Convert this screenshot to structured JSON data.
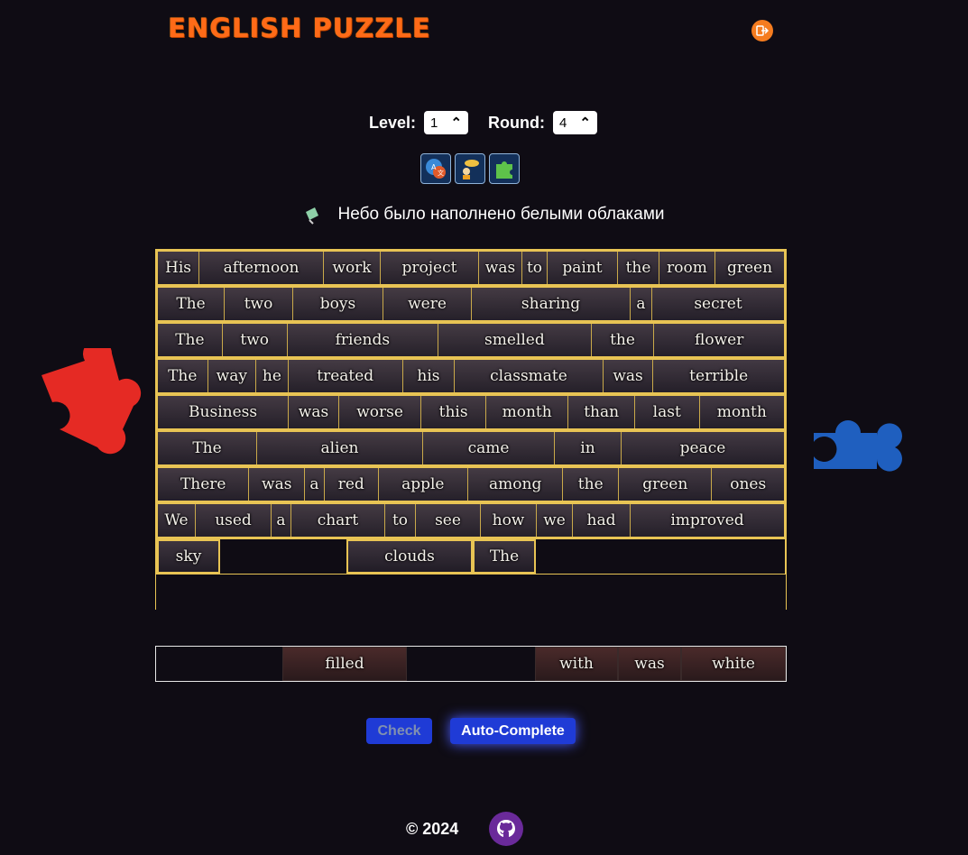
{
  "app": {
    "title": "ENGLISH PUZZLE"
  },
  "controls": {
    "level_label": "Level:",
    "level_value": "1",
    "round_label": "Round:",
    "round_value": "4"
  },
  "hints": [
    {
      "icon": "translate-icon"
    },
    {
      "icon": "audio-hint-icon"
    },
    {
      "icon": "puzzle-piece-icon"
    }
  ],
  "translation": "Небо было наполнено белыми облаками",
  "board": {
    "rows": [
      [
        "His",
        "afternoon",
        "work",
        "project",
        "was",
        "to",
        "paint",
        "the",
        "room",
        "green"
      ],
      [
        "The",
        "two",
        "boys",
        "were",
        "sharing",
        "a",
        "secret"
      ],
      [
        "The",
        "two",
        "friends",
        "smelled",
        "the",
        "flower"
      ],
      [
        "The",
        "way",
        "he",
        "treated",
        "his",
        "classmate",
        "was",
        "terrible"
      ],
      [
        "Business",
        "was",
        "worse",
        "this",
        "month",
        "than",
        "last",
        "month"
      ],
      [
        "The",
        "alien",
        "came",
        "in",
        "peace"
      ],
      [
        "There",
        "was",
        "a",
        "red",
        "apple",
        "among",
        "the",
        "green",
        "ones"
      ],
      [
        "We",
        "used",
        "a",
        "chart",
        "to",
        "see",
        "how",
        "we",
        "had",
        "improved"
      ]
    ],
    "current_row": [
      "sky",
      "",
      "clouds",
      "The"
    ]
  },
  "source_pieces": [
    "",
    "filled",
    "",
    "with",
    "was",
    "white"
  ],
  "buttons": {
    "check": "Check",
    "auto_complete": "Auto-Complete"
  },
  "footer": {
    "copyright": "© 2024",
    "github_icon": "github-icon"
  },
  "colors": {
    "background": "#0f0c14",
    "border": "#e8c454",
    "logo": "#ff6a18",
    "button": "#1f3bd6"
  }
}
